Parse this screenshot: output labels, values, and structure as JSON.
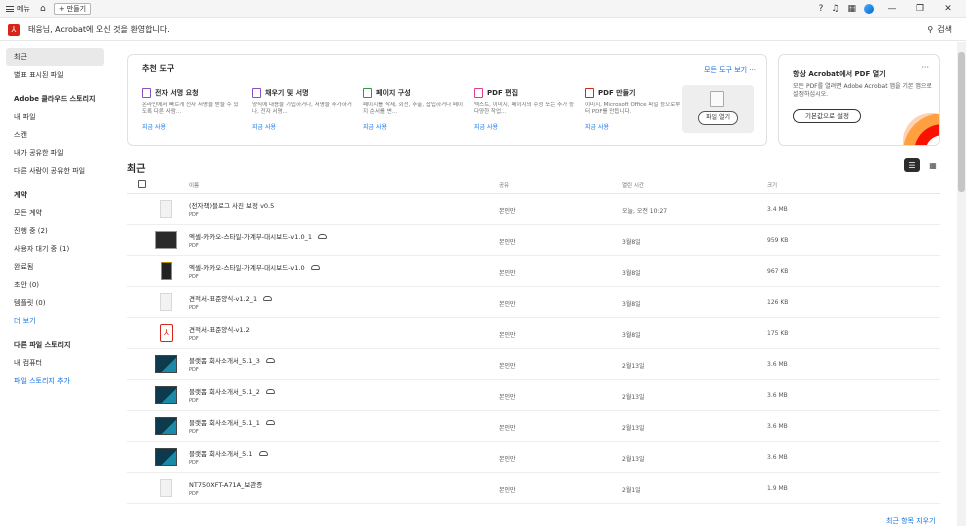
{
  "titlebar": {
    "menu_label": "메뉴",
    "create_label": "만들기"
  },
  "header": {
    "welcome": "태웅님, Acrobat에 오신 것을 환영합니다.",
    "search_label": "검색"
  },
  "sidebar": {
    "top": [
      {
        "label": "최근",
        "active": true
      },
      {
        "label": "별표 표시된 파일"
      }
    ],
    "cloud_section": "Adobe 클라우드 스토리지",
    "cloud_items": [
      "내 파일",
      "스캔",
      "내가 공유한 파일",
      "다른 사람이 공유한 파일"
    ],
    "agreements_section": "계약",
    "agreement_items": [
      "모든 계약",
      "진행 중 (2)",
      "사용자 대기 중 (1)",
      "완료됨",
      "초안 (0)",
      "템플릿 (0)"
    ],
    "more_label": "더 보기",
    "other_section": "다른 파일 스토리지",
    "other_items": [
      "내 컴퓨터"
    ],
    "add_storage": "파일 스토리지 추가"
  },
  "tools": {
    "title": "추천 도구",
    "see_all": "모든 도구 보기",
    "items": [
      {
        "name": "전자 서명 요청",
        "desc": "온라인에서 빠르게 전자 서명을 받을 수 있도록 다른 사람...",
        "use": "지금 사용",
        "color": "#8a4fc7"
      },
      {
        "name": "채우기 및 서명",
        "desc": "양식에 내용을 기입하거나, 서명을 추가하거나, 전자 서명...",
        "use": "지금 사용",
        "color": "#8a4fc7"
      },
      {
        "name": "페이지 구성",
        "desc": "페이지를 삭제, 회전, 추출, 삽입하거나 페이지 순서를 변...",
        "use": "지금 사용",
        "color": "#2d9d2d"
      },
      {
        "name": "PDF 편집",
        "desc": "텍스트, 이미지, 페이지의 수정 또는 추가 등 다양한 작업...",
        "use": "지금 사용",
        "color": "#e03e8c"
      },
      {
        "name": "PDF 만들기",
        "desc": "이미지, Microsoft Office 파일 등으로부터 PDF를 만듭니다.",
        "use": "지금 사용",
        "color": "#d7251b"
      }
    ],
    "open_file": "파일 열기"
  },
  "promo": {
    "title": "항상 Acrobat에서 PDF 열기",
    "desc": "모든 PDF를 열려면 Adobe Acrobat 앱을 기본 앱으로 설정하십시오.",
    "button": "기본값으로 설정"
  },
  "recent": {
    "title": "최근",
    "columns": {
      "name": "이름",
      "shared": "공유",
      "opened": "열린 시간",
      "size": "크기"
    },
    "files": [
      {
        "name": "(전자책)블로그 사진 보정 v0.5",
        "type": "PDF",
        "shared": "본인만",
        "opened": "오늘, 오전 10:27",
        "size": "3.4 MB",
        "thumb": "doc",
        "cloud": false
      },
      {
        "name": "엑셀-카카오-스타일-가계부-대시보드-v1.0_1",
        "type": "PDF",
        "shared": "본인만",
        "opened": "3월8일",
        "size": "959 KB",
        "thumb": "dark",
        "cloud": true
      },
      {
        "name": "엑셀-카카오-스타일-가계부-대시보드-v1.0",
        "type": "PDF",
        "shared": "본인만",
        "opened": "3월8일",
        "size": "967 KB",
        "thumb": "yellow",
        "cloud": true
      },
      {
        "name": "견적서-표준양식-v1.2_1",
        "type": "PDF",
        "shared": "본인만",
        "opened": "3월8일",
        "size": "126 KB",
        "thumb": "doc",
        "cloud": true
      },
      {
        "name": "견적서-표준양식-v1.2",
        "type": "PDF",
        "shared": "본인만",
        "opened": "3월8일",
        "size": "175 KB",
        "thumb": "pdf",
        "cloud": false
      },
      {
        "name": "블랫폼 회사소개서_5.1_3",
        "type": "PDF",
        "shared": "본인만",
        "opened": "2월13일",
        "size": "3.6 MB",
        "thumb": "deck",
        "cloud": true
      },
      {
        "name": "블랫폼 회사소개서_5.1_2",
        "type": "PDF",
        "shared": "본인만",
        "opened": "2월13일",
        "size": "3.6 MB",
        "thumb": "deck",
        "cloud": true
      },
      {
        "name": "블랫폼 회사소개서_5.1_1",
        "type": "PDF",
        "shared": "본인만",
        "opened": "2월13일",
        "size": "3.6 MB",
        "thumb": "deck",
        "cloud": true
      },
      {
        "name": "블랫폼 회사소개서_5.1",
        "type": "PDF",
        "shared": "본인만",
        "opened": "2월13일",
        "size": "3.6 MB",
        "thumb": "deck",
        "cloud": true
      },
      {
        "name": "NT750XFT-A71A_보관증",
        "type": "PDF",
        "shared": "본인만",
        "opened": "2월1일",
        "size": "1.9 MB",
        "thumb": "doc",
        "cloud": false
      }
    ],
    "clear_label": "최근 항목 지우기"
  }
}
